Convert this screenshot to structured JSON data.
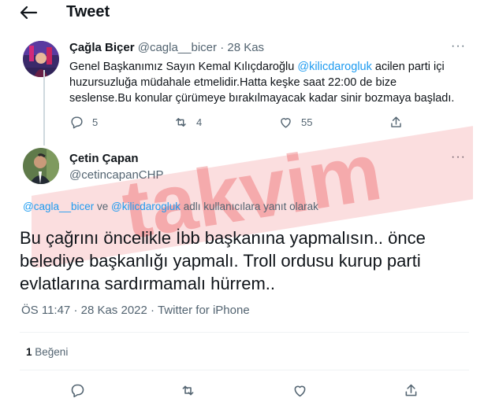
{
  "header": {
    "title": "Tweet"
  },
  "parent_tweet": {
    "author_name": "Çağla Biçer",
    "author_handle": "@cagla__bicer",
    "separator": "·",
    "date": "28 Kas",
    "text_line1_prefix": "Genel Başkanımız Sayın Kemal Kılıçdaroğlu ",
    "mention": "@kilicdarogluk",
    "text_line1_suffix": " acilen parti içi",
    "text_line2": "huzursuzluğa müdahale  etmelidir.Hatta keşke saat 22:00 de bize",
    "text_line3": "seslense.Bu konular çürümeye bırakılmayacak kadar sinir bozmaya başladı.",
    "replies": "5",
    "retweets": "4",
    "likes": "55"
  },
  "main_tweet": {
    "author_name": "Çetin Çapan",
    "author_handle": "@cetincapanCHP",
    "reply_to_mention1": "@cagla__bicer",
    "reply_to_ve": " ve ",
    "reply_to_mention2": "@kilicdarogluk",
    "reply_to_suffix": " adlı kullanıcılara yanıt olarak",
    "text_line1": "Bu çağrını öncelikle İbb başkanına yapmalısın.. önce",
    "text_line2": "belediye başkanlığı yapmalı. Troll ordusu kurup parti",
    "text_line3": "evlatlarına sardırmamalı hürrem..",
    "time": "ÖS 11:47",
    "separator": "·",
    "date": "28 Kas 2022",
    "source": "Twitter for iPhone",
    "like_count": "1",
    "like_label": "Beğeni"
  },
  "watermark": {
    "text": "takvim",
    "color": "#e8343a"
  },
  "colors": {
    "link": "#1d9bf0",
    "muted": "#536471",
    "text": "#0f1419"
  }
}
